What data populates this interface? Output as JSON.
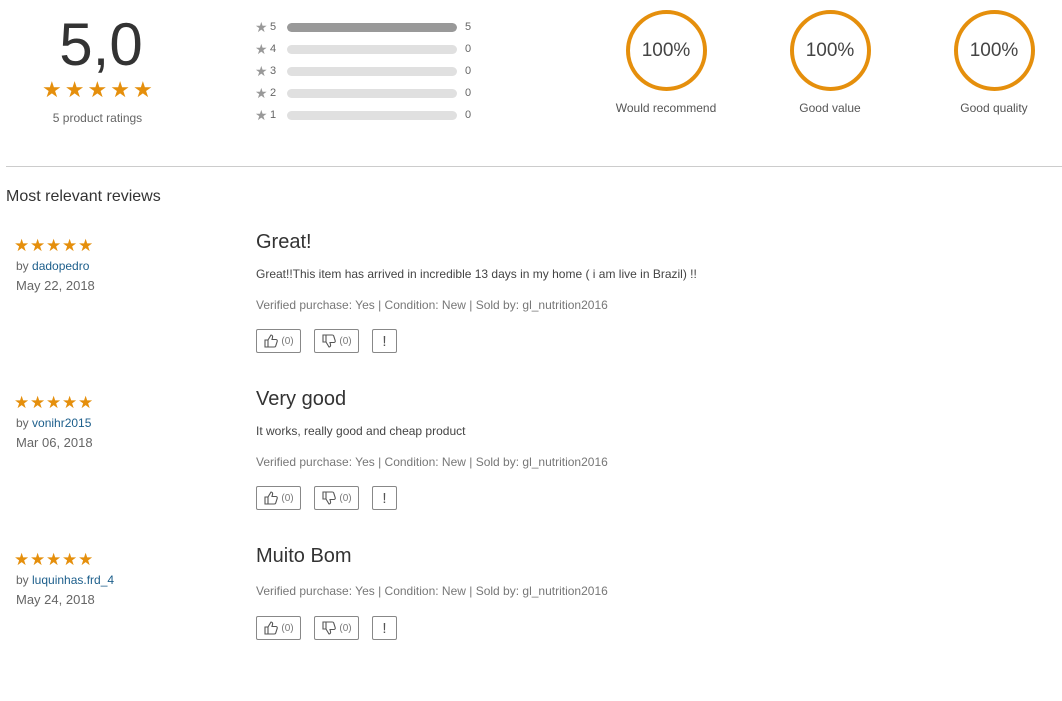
{
  "summary": {
    "score": "5,0",
    "stars": 5,
    "ratings_count": "5 product ratings",
    "distribution": [
      {
        "label": "5",
        "count": "5",
        "fraction": 1.0
      },
      {
        "label": "4",
        "count": "0",
        "fraction": 0
      },
      {
        "label": "3",
        "count": "0",
        "fraction": 0
      },
      {
        "label": "2",
        "count": "0",
        "fraction": 0
      },
      {
        "label": "1",
        "count": "0",
        "fraction": 0
      }
    ],
    "metrics": [
      {
        "value": "100%",
        "label": "Would recommend"
      },
      {
        "value": "100%",
        "label": "Good value"
      },
      {
        "value": "100%",
        "label": "Good quality"
      }
    ]
  },
  "section_title": "Most relevant reviews",
  "reviews": [
    {
      "stars": 5,
      "by": "by ",
      "author": "dadopedro",
      "date": "May 22, 2018",
      "title": "Great!",
      "body": "Great!!This item has arrived in incredible 13 days in my home ( i am live in Brazil) !!",
      "meta": "Verified purchase: Yes | Condition: New | Sold by: gl_nutrition2016",
      "helpful": "(0)",
      "unhelpful": "(0)",
      "report": "!"
    },
    {
      "stars": 5,
      "by": "by ",
      "author": "vonihr2015",
      "date": "Mar 06, 2018",
      "title": "Very good",
      "body": "It works, really good and cheap product",
      "meta": "Verified purchase: Yes | Condition: New | Sold by: gl_nutrition2016",
      "helpful": "(0)",
      "unhelpful": "(0)",
      "report": "!"
    },
    {
      "stars": 5,
      "by": "by ",
      "author": "luquinhas.frd_4",
      "date": "May 24, 2018",
      "title": "Muito Bom",
      "body": "",
      "meta": "Verified purchase: Yes | Condition: New | Sold by: gl_nutrition2016",
      "helpful": "(0)",
      "unhelpful": "(0)",
      "report": "!"
    }
  ],
  "colors": {
    "accent": "#e58f0c",
    "link": "#1c5e8b"
  },
  "icons": {
    "star": "star-icon",
    "thumbs_up": "thumbs-up-icon",
    "thumbs_down": "thumbs-down-icon"
  }
}
